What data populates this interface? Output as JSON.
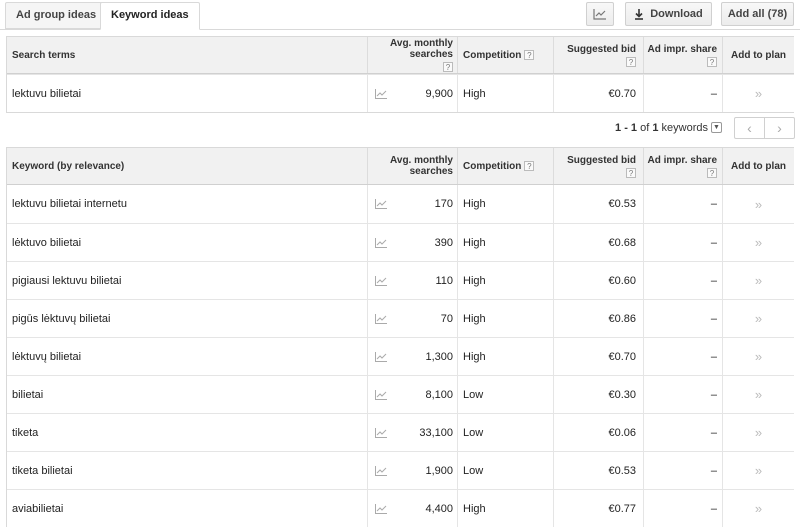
{
  "tabs": [
    {
      "label": "Ad group ideas",
      "active": false
    },
    {
      "label": "Keyword ideas",
      "active": true
    }
  ],
  "toolbar": {
    "download_label": "Download",
    "add_all_label": "Add all (78)"
  },
  "columns": {
    "search_terms": "Search terms",
    "keyword": "Keyword (by relevance)",
    "avg_monthly_searches": "Avg. monthly searches",
    "competition": "Competition",
    "suggested_bid": "Suggested bid",
    "ad_impr_share": "Ad impr. share",
    "add_to_plan": "Add to plan",
    "help_mark": "?"
  },
  "search_terms": [
    {
      "keyword": "lektuvu bilietai",
      "searches": "9,900",
      "competition": "High",
      "bid": "€0.70",
      "impr": "–",
      "add": "»"
    }
  ],
  "pagination": {
    "range": "1 - 1",
    "of_word": "of",
    "count": "1",
    "unit": "keywords",
    "prev": "‹",
    "next": "›"
  },
  "keywords": [
    {
      "keyword": "lektuvu bilietai internetu",
      "searches": "170",
      "competition": "High",
      "bid": "€0.53",
      "impr": "–",
      "add": "»"
    },
    {
      "keyword": "lėktuvo bilietai",
      "searches": "390",
      "competition": "High",
      "bid": "€0.68",
      "impr": "–",
      "add": "»"
    },
    {
      "keyword": "pigiausi lektuvu bilietai",
      "searches": "110",
      "competition": "High",
      "bid": "€0.60",
      "impr": "–",
      "add": "»"
    },
    {
      "keyword": "pigūs lėktuvų bilietai",
      "searches": "70",
      "competition": "High",
      "bid": "€0.86",
      "impr": "–",
      "add": "»"
    },
    {
      "keyword": "lėktuvų bilietai",
      "searches": "1,300",
      "competition": "High",
      "bid": "€0.70",
      "impr": "–",
      "add": "»"
    },
    {
      "keyword": "bilietai",
      "searches": "8,100",
      "competition": "Low",
      "bid": "€0.30",
      "impr": "–",
      "add": "»"
    },
    {
      "keyword": "tiketa",
      "searches": "33,100",
      "competition": "Low",
      "bid": "€0.06",
      "impr": "–",
      "add": "»"
    },
    {
      "keyword": "tiketa bilietai",
      "searches": "1,900",
      "competition": "Low",
      "bid": "€0.53",
      "impr": "–",
      "add": "»"
    },
    {
      "keyword": "aviabilietai",
      "searches": "4,400",
      "competition": "High",
      "bid": "€0.77",
      "impr": "–",
      "add": "»"
    }
  ]
}
